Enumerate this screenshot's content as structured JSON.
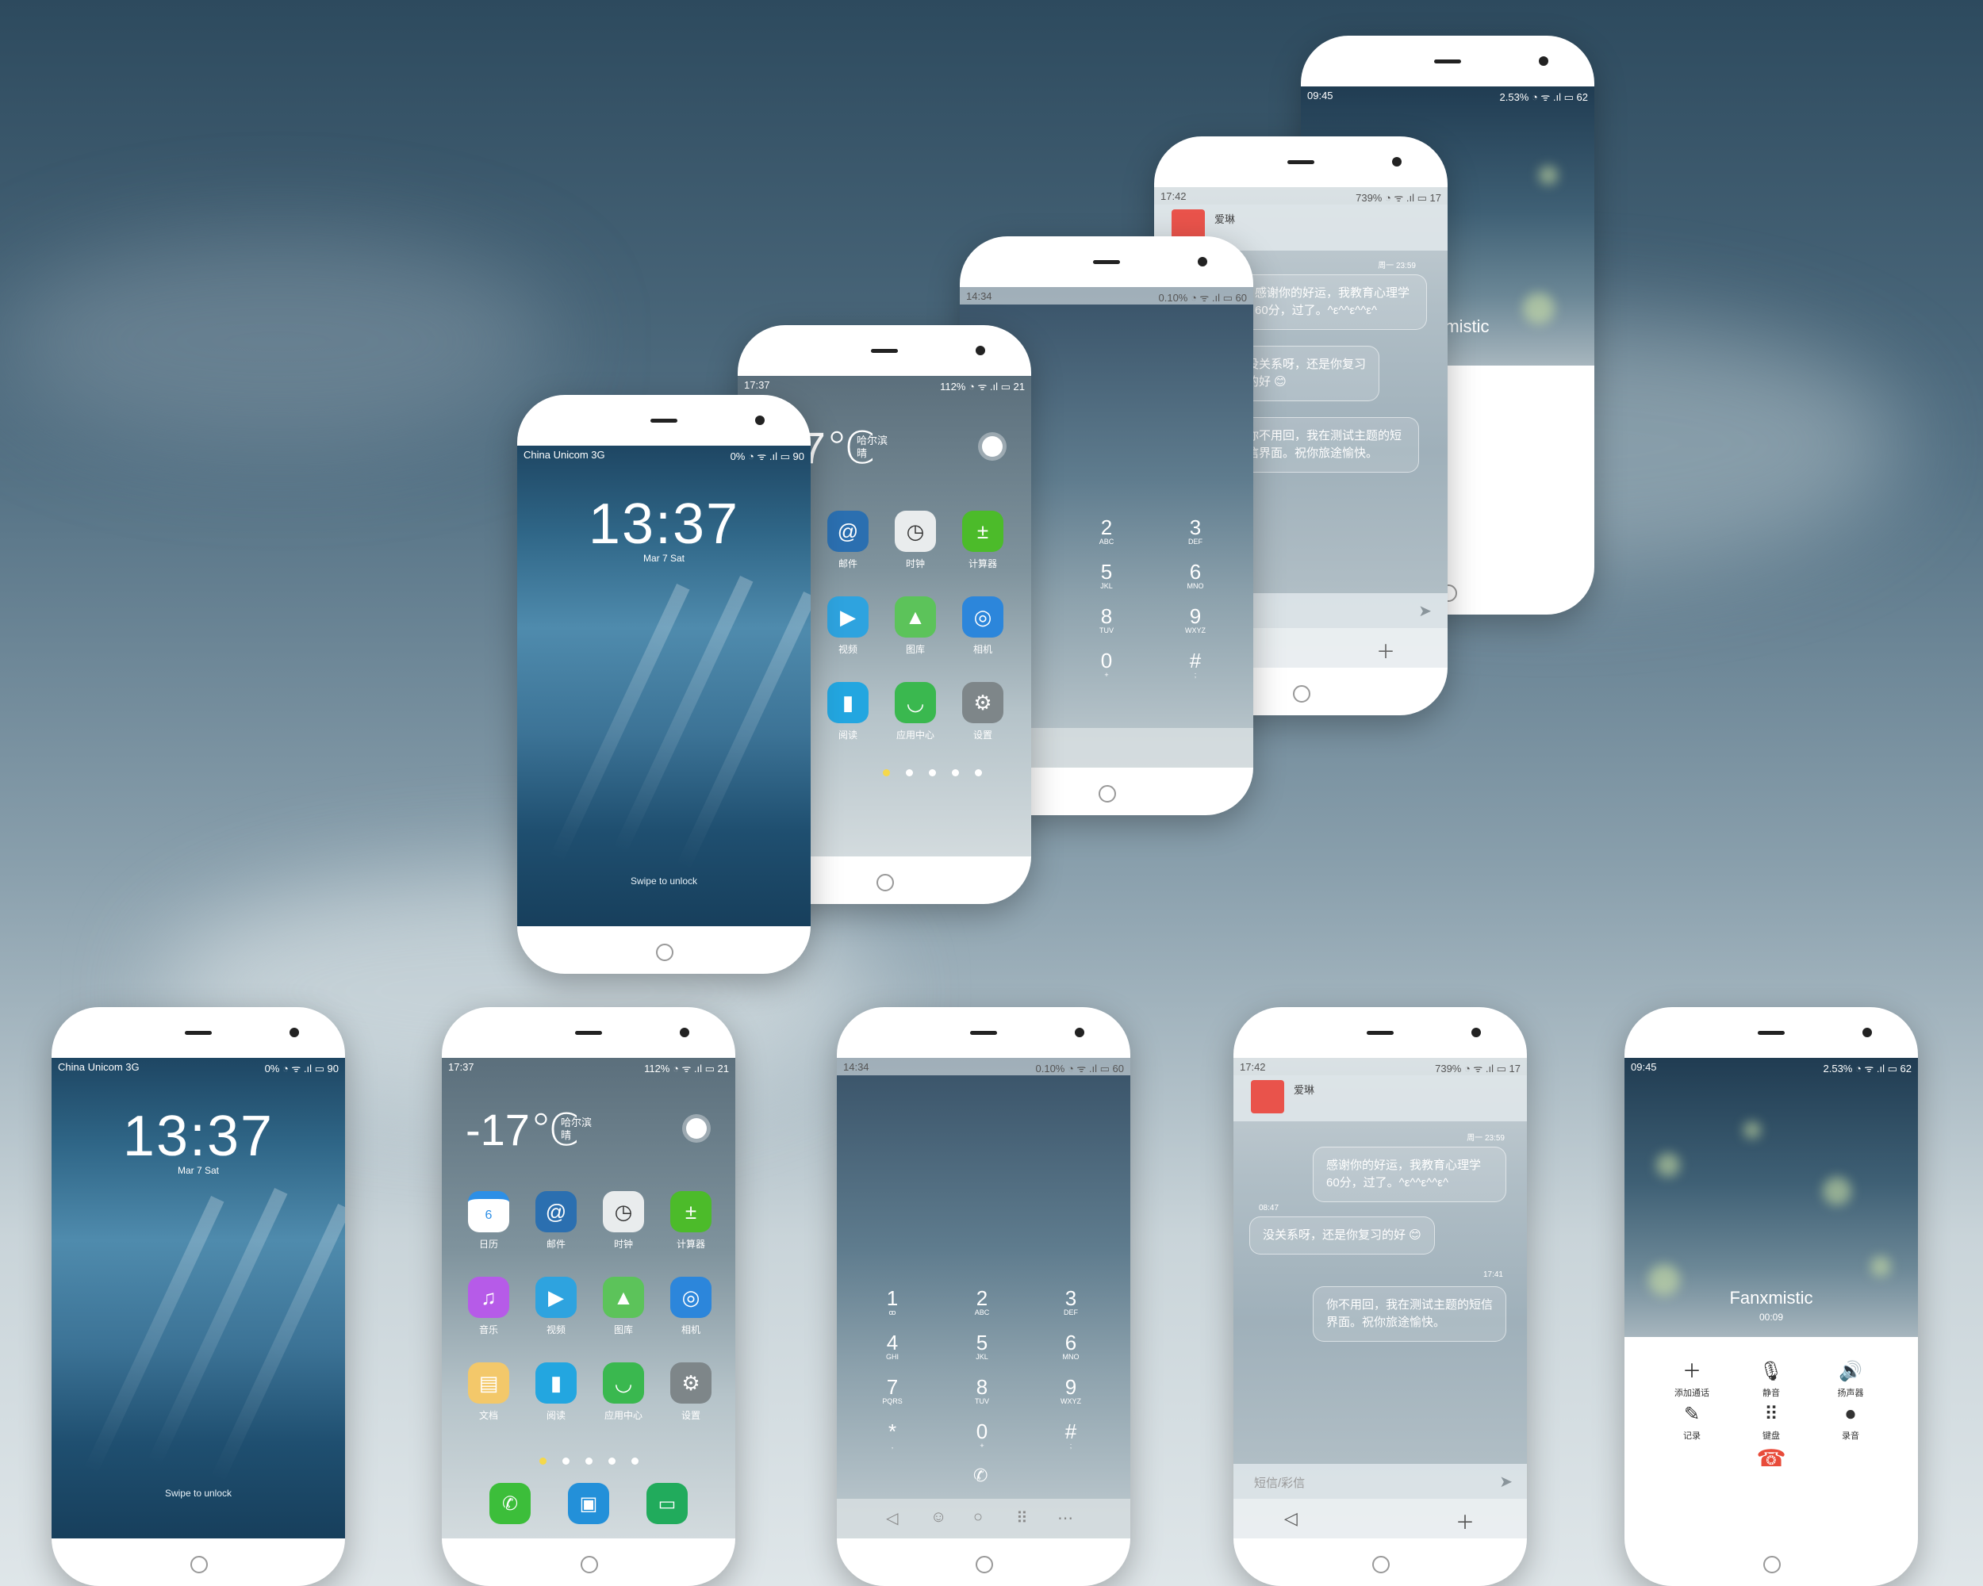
{
  "lock": {
    "carrier": "China Unicom 3G",
    "status_right": "0%  ◔ ᯤ .ıl ▭ 90",
    "time": "13:37",
    "date": "Mar 7  Sat",
    "swipe": "Swipe to unlock"
  },
  "home": {
    "status_time": "17:37",
    "status_right": "112%  ◔ ᯤ .ıl ▭ 21",
    "temp": "-17℃",
    "city": "哈尔滨",
    "weather": "晴",
    "apps": [
      {
        "label": "日历",
        "icon": "calendar-icon",
        "color": "#2d8fe6"
      },
      {
        "label": "邮件",
        "icon": "mail-icon",
        "color": "#2b6fb0"
      },
      {
        "label": "时钟",
        "icon": "clock-icon",
        "color": "#e9eced"
      },
      {
        "label": "计算器",
        "icon": "calculator-icon",
        "color": "#4cbb2a"
      },
      {
        "label": "音乐",
        "icon": "music-icon",
        "color": "#b65be8"
      },
      {
        "label": "视频",
        "icon": "video-icon",
        "color": "#2ea3df"
      },
      {
        "label": "图库",
        "icon": "gallery-icon",
        "color": "#5cc35a"
      },
      {
        "label": "相机",
        "icon": "camera-icon",
        "color": "#2c86db"
      },
      {
        "label": "文档",
        "icon": "document-icon",
        "color": "#f3c86a"
      },
      {
        "label": "阅读",
        "icon": "reader-icon",
        "color": "#23a6e0"
      },
      {
        "label": "应用中心",
        "icon": "app-center-icon",
        "color": "#3ab84f"
      },
      {
        "label": "设置",
        "icon": "settings-icon",
        "color": "#7e8689"
      }
    ],
    "dock": [
      {
        "icon": "phone-icon",
        "color": "#3cbe3a"
      },
      {
        "icon": "browser-icon",
        "color": "#2390d9"
      },
      {
        "icon": "messages-icon",
        "color": "#21ab5c"
      }
    ]
  },
  "dialer": {
    "status_time": "14:34",
    "status_right": "0.10%  ◔ ᯤ .ıl ▭ 60",
    "keys": [
      {
        "n": "1",
        "s": "ꝏ"
      },
      {
        "n": "2",
        "s": "ABC"
      },
      {
        "n": "3",
        "s": "DEF"
      },
      {
        "n": "4",
        "s": "GHI"
      },
      {
        "n": "5",
        "s": "JKL"
      },
      {
        "n": "6",
        "s": "MNO"
      },
      {
        "n": "7",
        "s": "PQRS"
      },
      {
        "n": "8",
        "s": "TUV"
      },
      {
        "n": "9",
        "s": "WXYZ"
      },
      {
        "n": "*",
        "s": ","
      },
      {
        "n": "0",
        "s": "+"
      },
      {
        "n": "#",
        "s": ";"
      }
    ]
  },
  "sms": {
    "status_time": "17:42",
    "status_right": "739%  ◔ ᯤ .ıl ▭ 17",
    "contact": "爱琳",
    "t1": "周一 23:59",
    "m1": "感谢你的好运，我教育心理学60分，过了。^ε^^ε^^ε^",
    "t2": "08:47",
    "m2": "没关系呀，还是你复习的好 😊",
    "t3": "17:41",
    "m3": "你不用回，我在测试主题的短信界面。祝你旅途愉快。",
    "placeholder": "短信/彩信"
  },
  "call": {
    "status_time": "09:45",
    "status_right": "2.53%  ◔ ᯤ .ıl ▭ 62",
    "caller": "Fanxmistic",
    "duration": "00:09",
    "buttons": [
      {
        "label": "添加通话",
        "icon": "add-call-icon",
        "glyph": "＋"
      },
      {
        "label": "静音",
        "icon": "mute-icon",
        "glyph": "🎙"
      },
      {
        "label": "扬声器",
        "icon": "speaker-icon",
        "glyph": "🔊"
      },
      {
        "label": "记录",
        "icon": "note-icon",
        "glyph": "✎"
      },
      {
        "label": "键盘",
        "icon": "keypad-icon",
        "glyph": "⠿"
      },
      {
        "label": "录音",
        "icon": "record-icon",
        "glyph": "⏺"
      }
    ]
  }
}
